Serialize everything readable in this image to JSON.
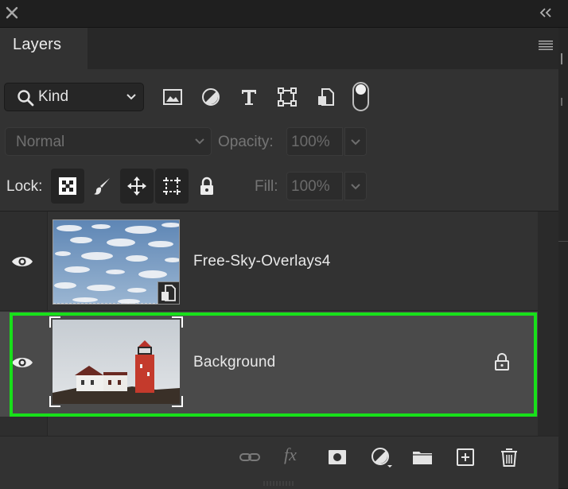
{
  "panel": {
    "tab_title": "Layers"
  },
  "filter": {
    "kind_label": "Kind",
    "icons": [
      "image-filter-icon",
      "adjustment-filter-icon",
      "type-filter-icon",
      "shape-filter-icon",
      "smart-object-filter-icon"
    ]
  },
  "blend": {
    "mode": "Normal",
    "opacity_label": "Opacity:",
    "opacity_value": "100%"
  },
  "lock": {
    "label": "Lock:",
    "fill_label": "Fill:",
    "fill_value": "100%",
    "icons": [
      "lock-transparent-pixels-icon",
      "lock-image-pixels-icon",
      "lock-position-icon",
      "lock-artboard-icon",
      "lock-all-icon"
    ]
  },
  "layers": [
    {
      "name": "Free-Sky-Overlays4",
      "visible": true,
      "selected": false,
      "smart_object": true
    },
    {
      "name": "Background",
      "visible": true,
      "selected": true,
      "locked": true
    }
  ],
  "bottom_bar": {
    "fx_label": "fx",
    "icons": [
      "link-layers-icon",
      "fx-icon",
      "layer-mask-icon",
      "adjustment-layer-icon",
      "group-folder-icon",
      "new-layer-icon",
      "delete-layer-icon"
    ]
  },
  "colors": {
    "panel_bg": "#323232",
    "selected_row": "#4a4a4a",
    "selection_outline": "#18e01a"
  }
}
